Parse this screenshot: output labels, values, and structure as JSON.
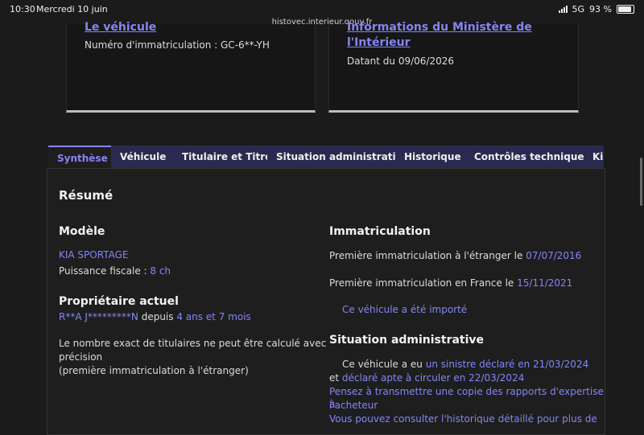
{
  "status": {
    "time": "10:30",
    "date": "Mercredi 10 juin",
    "network": "5G",
    "battery": "93 %"
  },
  "url": "histovec.interieur.gouv.fr",
  "card1": {
    "title": "Le véhicule",
    "text": "Numéro d'immatriculation : GC-6**-YH"
  },
  "card2": {
    "title_line1": "Informations du Ministère de",
    "title_line2": "l'Intérieur",
    "text": "Datant du 09/06/2026"
  },
  "tabs": [
    "Synthèse",
    "Véhicule",
    "Titulaire et Titre",
    "Situation administrative",
    "Historique",
    "Contrôles techniques",
    "Kilométrage"
  ],
  "summary": {
    "heading": "Résumé",
    "model": {
      "heading": "Modèle",
      "name": "KIA SPORTAGE",
      "power_label": "Puissance fiscale : ",
      "power_value": "8 ch"
    },
    "owner": {
      "heading": "Propriétaire actuel",
      "name": "R**A J*********N",
      "since_label": " depuis ",
      "duration": "4 ans et 7 mois",
      "note_line1": "Le nombre exact de titulaires ne peut être calculé avec",
      "note_line2": "précision",
      "note_line3": "(première immatriculation à l'étranger)"
    },
    "registration": {
      "heading": "Immatriculation",
      "abroad_label": "Première immatriculation à l'étranger le ",
      "abroad_date": "07/07/2016",
      "france_label": "Première immatriculation en France le ",
      "france_date": "15/11/2021",
      "imported": "Ce véhicule a été importé"
    },
    "admin": {
      "heading": "Situation administrative",
      "prefix": "Ce véhicule a eu ",
      "sinistre": "un sinistre déclaré en 21/03/2024",
      "and": "et ",
      "apte": "déclaré apte à circuler en 22/03/2024",
      "advice_line1": "Pensez à transmettre une copie des rapports d'expertise à",
      "advice_line2": "l'acheteur",
      "more_line": "Vous pouvez consulter l'historique détaillé pour plus de"
    }
  }
}
